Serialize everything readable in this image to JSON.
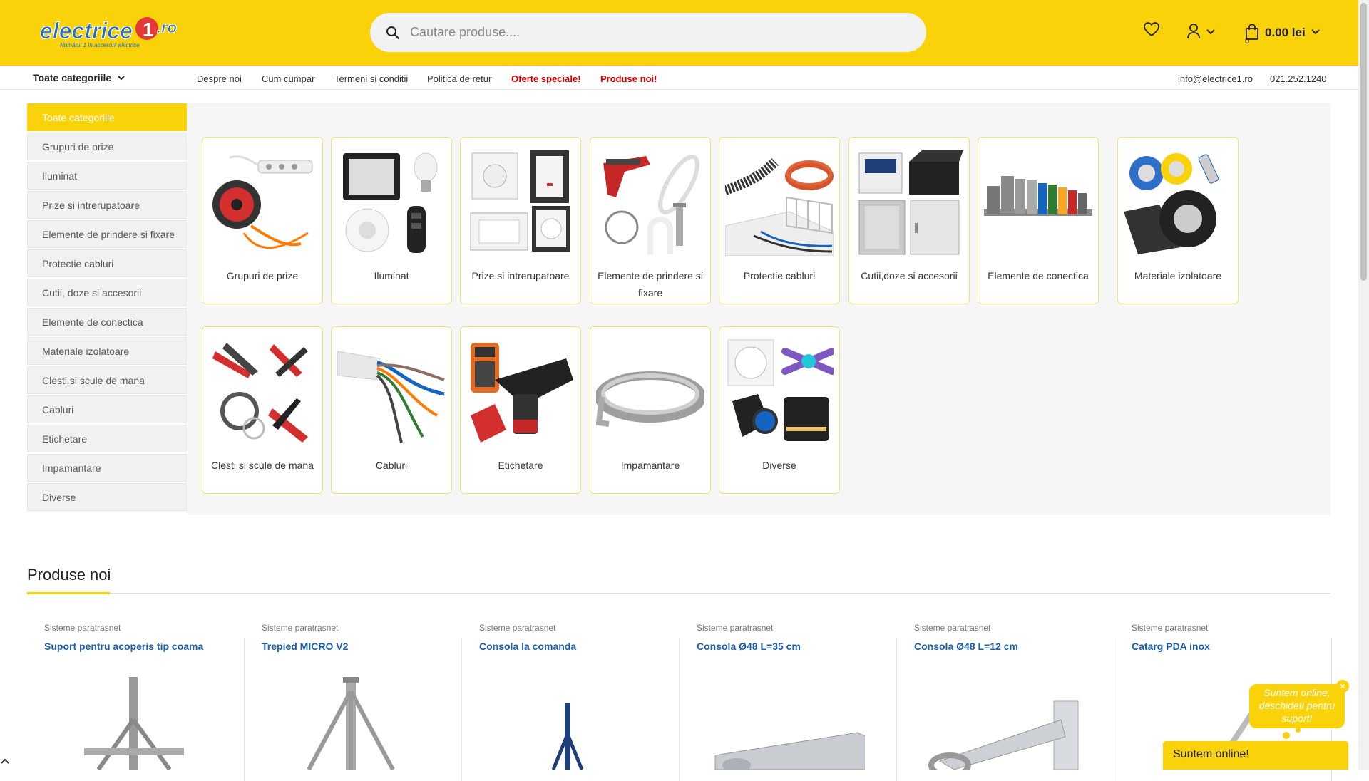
{
  "header": {
    "logo_text": "electrice1.ro",
    "logo_tagline": "Numărul 1 în accesorii electrice",
    "search_placeholder": "Cautare produse....",
    "cart_total": "0.00 lei",
    "cart_count": "0"
  },
  "nav": {
    "categories_label": "Toate categoriile",
    "links": [
      "Despre noi",
      "Cum cumpar",
      "Termeni si conditii",
      "Politica de retur"
    ],
    "red_links": [
      "Oferte speciale!",
      "Produse noi!"
    ],
    "email": "info@electrice1.ro",
    "phone": "021.252.1240"
  },
  "sidebar": {
    "items": [
      "Toate categoriile",
      "Grupuri de prize",
      "Iluminat",
      "Prize si intrerupatoare",
      "Elemente de prindere si fixare",
      "Protectie cabluri",
      "Cutii, doze si accesorii",
      "Elemente de conectica",
      "Materiale izolatoare",
      "Clesti si scule de mana",
      "Cabluri",
      "Etichetare",
      "Impamantare",
      "Diverse"
    ]
  },
  "categories": [
    {
      "label": "Grupuri de prize",
      "icon": "power-strip-icon"
    },
    {
      "label": "Iluminat",
      "icon": "lighting-icon"
    },
    {
      "label": "Prize si intrerupatoare",
      "icon": "socket-icon"
    },
    {
      "label": "Elemente de prindere si fixare",
      "icon": "cable-tie-icon"
    },
    {
      "label": "Protectie cabluri",
      "icon": "cable-conduit-icon"
    },
    {
      "label": "Cutii,doze si accesorii",
      "icon": "junction-box-icon"
    },
    {
      "label": "Elemente de conectica",
      "icon": "terminal-block-icon"
    },
    {
      "label": "Materiale izolatoare",
      "icon": "insulating-tape-icon"
    },
    {
      "label": "Clesti si scule de mana",
      "icon": "pliers-icon"
    },
    {
      "label": "Cabluri",
      "icon": "cable-icon"
    },
    {
      "label": "Etichetare",
      "icon": "label-printer-icon"
    },
    {
      "label": "Impamantare",
      "icon": "grounding-strip-icon"
    },
    {
      "label": "Diverse",
      "icon": "misc-icon"
    }
  ],
  "new_products": {
    "title": "Produse noi",
    "items": [
      {
        "category": "Sisteme paratrasnet",
        "name": "Suport pentru acoperis tip coama"
      },
      {
        "category": "Sisteme paratrasnet",
        "name": "Trepied MICRO V2"
      },
      {
        "category": "Sisteme paratrasnet",
        "name": "Consola la comanda"
      },
      {
        "category": "Sisteme paratrasnet",
        "name": "Consola Ø48 L=35 cm"
      },
      {
        "category": "Sisteme paratrasnet",
        "name": "Consola Ø48 L=12 cm"
      },
      {
        "category": "Sisteme paratrasnet",
        "name": "Catarg PDA inox"
      }
    ]
  },
  "chat": {
    "bubble_text": "Suntem online, deschideti pentru suport!",
    "bar_text": "Suntem online!",
    "close": "×"
  },
  "colors": {
    "brand_yellow": "#f9d20a",
    "link_blue": "#1d5fa8",
    "nav_red": "#d50000"
  }
}
